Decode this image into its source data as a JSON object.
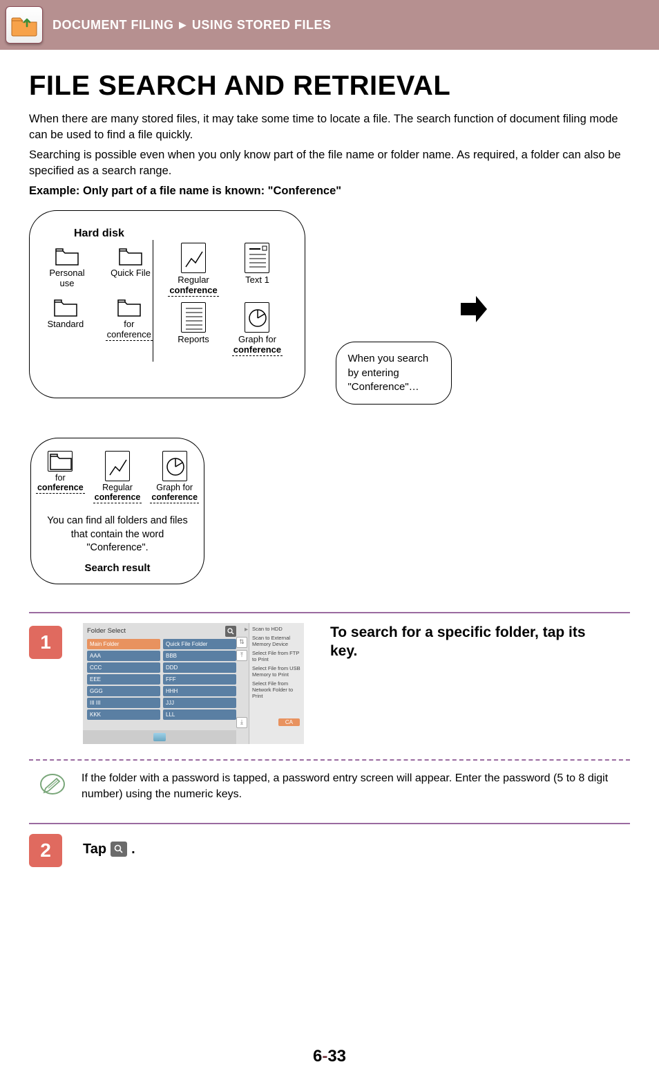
{
  "header": {
    "crumb1": "DOCUMENT FILING",
    "sep": "►",
    "crumb2": "USING STORED FILES"
  },
  "title": "FILE SEARCH AND RETRIEVAL",
  "intro1": "When there are many stored files, it may take some time to locate a file. The search function of document filing mode can be used to find a file quickly.",
  "intro2": "Searching is possible even when you only know part of the file name or folder name. As required, a folder can also be specified as a search range.",
  "example": "Example: Only part of a file name is known: \"Conference\"",
  "diagram": {
    "hd_title": "Hard disk",
    "folders": {
      "personal": "Personal use",
      "quickfile": "Quick File",
      "standard": "Standard",
      "for": "for",
      "conference": "conference"
    },
    "docs": {
      "regular": "Regular",
      "text1": "Text 1",
      "reports": "Reports",
      "graphfor": "Graph for",
      "conference": "conference"
    },
    "bubble": "When you search by entering \"Conference\"…",
    "result": {
      "items": [
        {
          "l1": "for",
          "l2": "conference"
        },
        {
          "l1": "Regular",
          "l2": "conference"
        },
        {
          "l1": "Graph for",
          "l2": "conference"
        }
      ],
      "note": "You can find all folders and files that contain the word \"Conference\".",
      "label": "Search result"
    }
  },
  "step1": {
    "num": "1",
    "heading": "To search for a specific folder, tap its key.",
    "panel": {
      "title": "Folder Select",
      "main": "Main Folder",
      "qff": "Quick File Folder",
      "rows": [
        [
          "AAA",
          "BBB"
        ],
        [
          "CCC",
          "DDD"
        ],
        [
          "EEE",
          "FFF"
        ],
        [
          "GGG",
          "HHH"
        ],
        [
          "III III",
          "JJJ"
        ],
        [
          "KKK",
          "LLL"
        ]
      ],
      "right": [
        "Scan to HDD",
        "Scan to External Memory Device",
        "Select File from FTP to Print",
        "Select File from USB Memory to Print",
        "Select File from Network Folder to Print"
      ],
      "ca": "CA"
    }
  },
  "note": "If the folder with a password is tapped, a password entry screen will appear. Enter the password (5 to 8 digit number) using the numeric keys.",
  "step2": {
    "num": "2",
    "pre": "Tap ",
    "post": "."
  },
  "page": {
    "a": "6",
    "b": "-",
    "c": "33"
  }
}
